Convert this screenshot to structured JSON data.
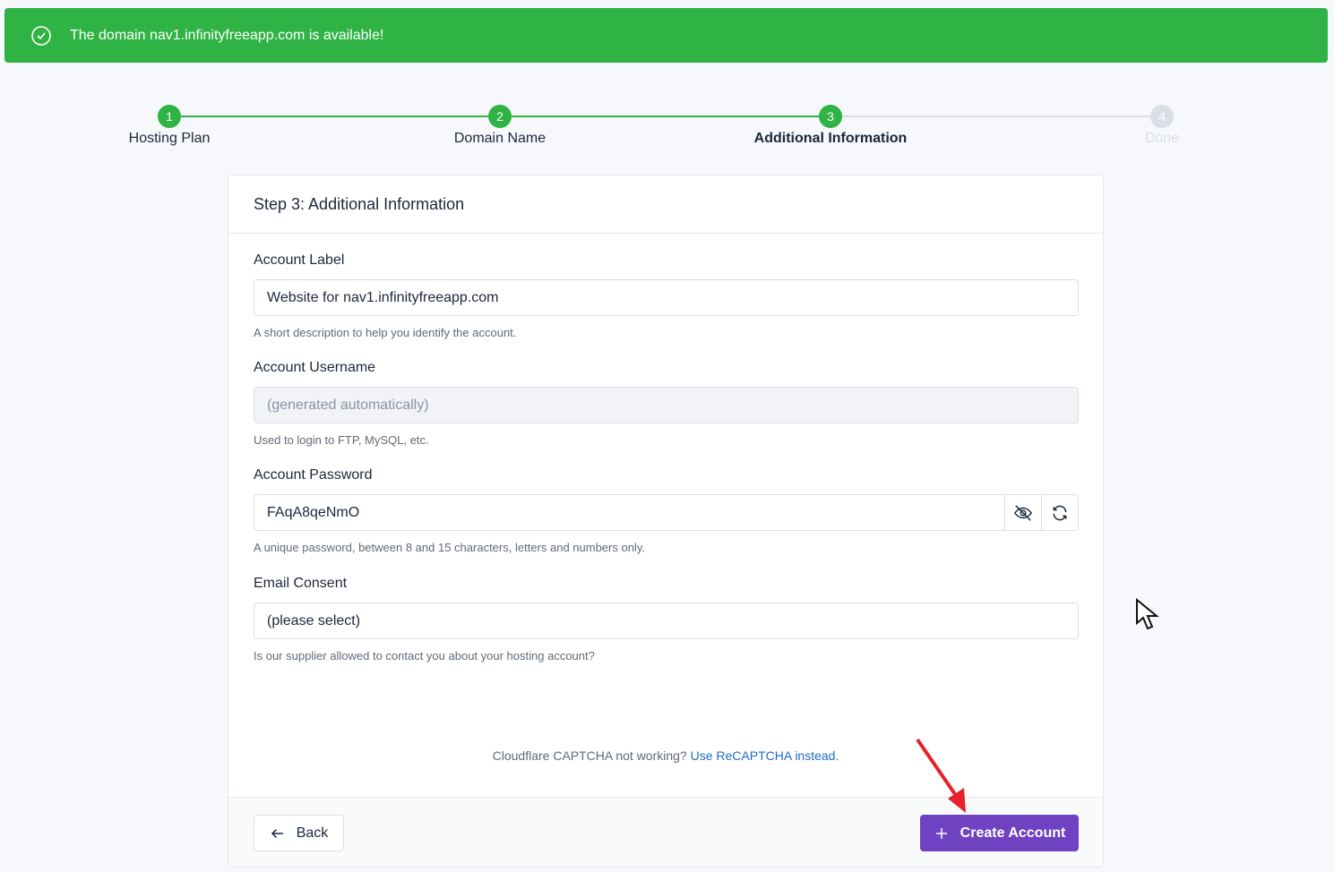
{
  "banner": {
    "message": "The domain nav1.infinityfreeapp.com is available!",
    "icon": "check-circle-icon",
    "color": "#2fb344"
  },
  "steps": [
    {
      "number": "1",
      "label": "Hosting Plan",
      "state": "complete"
    },
    {
      "number": "2",
      "label": "Domain Name",
      "state": "complete"
    },
    {
      "number": "3",
      "label": "Additional Information",
      "state": "active"
    },
    {
      "number": "4",
      "label": "Done",
      "state": "pending"
    }
  ],
  "card": {
    "title": "Step 3: Additional Information",
    "account_label": {
      "label": "Account Label",
      "value": "Website for nav1.infinityfreeapp.com",
      "hint": "A short description to help you identify the account."
    },
    "account_username": {
      "label": "Account Username",
      "placeholder": "(generated automatically)",
      "hint": "Used to login to FTP, MySQL, etc."
    },
    "account_password": {
      "label": "Account Password",
      "value": "FAqA8qeNmO",
      "hint": "A unique password, between 8 and 15 characters, letters and numbers only."
    },
    "email_consent": {
      "label": "Email Consent",
      "value": "(please select)",
      "hint": "Is our supplier allowed to contact you about your hosting account?"
    },
    "captcha": {
      "text": "Cloudflare CAPTCHA not working?",
      "link": "Use ReCAPTCHA instead."
    },
    "back_label": "Back",
    "create_label": "Create Account",
    "accent": "#6f42c1"
  }
}
